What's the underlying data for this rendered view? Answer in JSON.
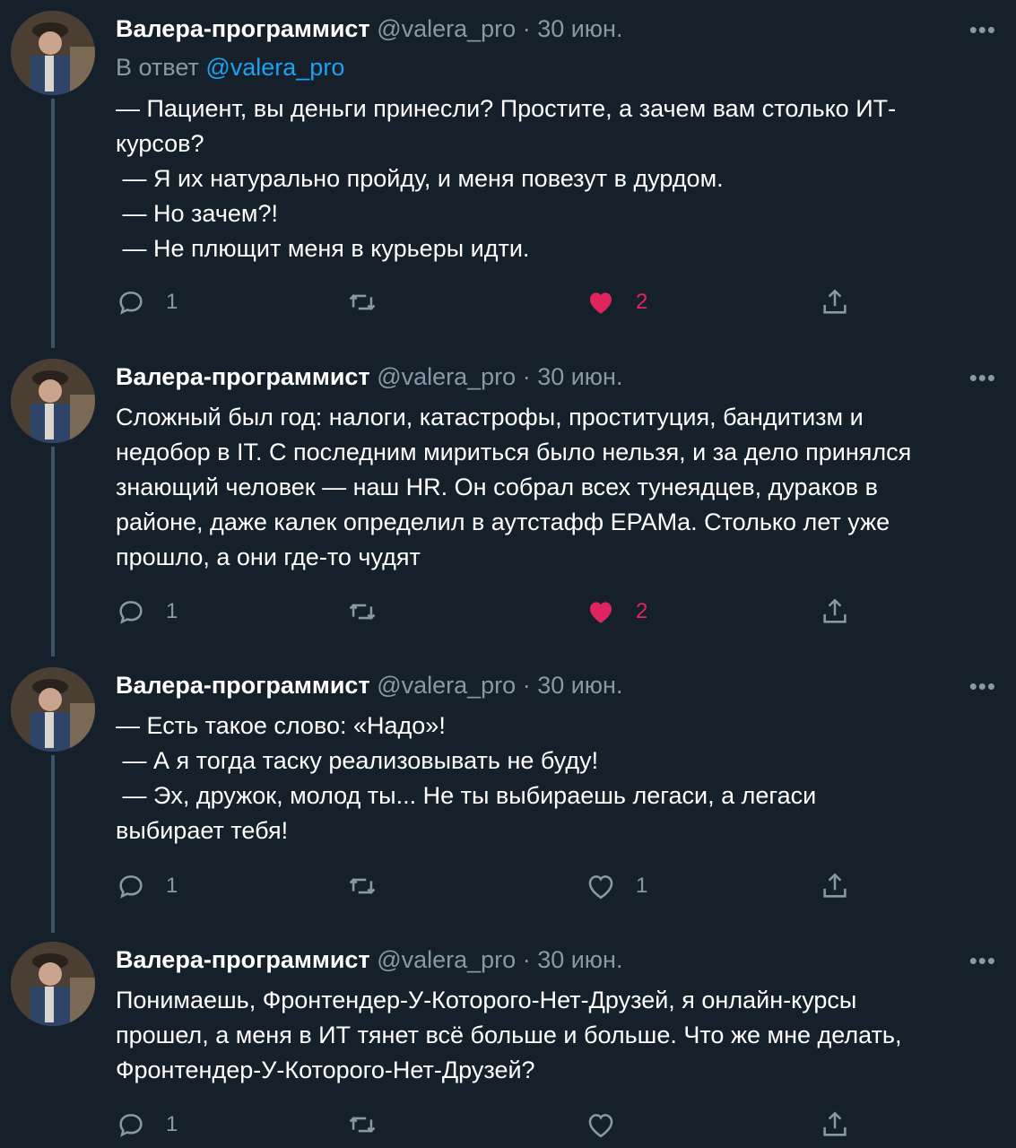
{
  "tweets": [
    {
      "name": "Валера-программист",
      "handle": "@valera_pro",
      "date": "· 30 июн.",
      "more": "•••",
      "reply_prefix": "В ответ",
      "reply_handle": "@valera_pro",
      "text": "— Пациент, вы деньги принесли? Простите, а зачем вам столько ИТ-\nкурсов?\n — Я их натурально пройду, и меня повезут в дурдом.\n — Но зачем?!\n — Не плющит меня в курьеры идти.",
      "reply_count": "1",
      "retweet_count": "",
      "like_count": "2",
      "liked": true
    },
    {
      "name": "Валера-программист",
      "handle": "@valera_pro",
      "date": "· 30 июн.",
      "more": "•••",
      "text": "Сложный был год: налоги, катастрофы, проституция, бандитизм и\nнедобор в IT. С последним мириться было нельзя, и за дело принялся\nзнающий человек — наш HR. Он собрал всех тунеядцев, дураков в\nрайоне, даже калек определил в аутстафф EPAMа. Столько лет уже\nпрошло, а они где-то чудят",
      "reply_count": "1",
      "retweet_count": "",
      "like_count": "2",
      "liked": true
    },
    {
      "name": "Валера-программист",
      "handle": "@valera_pro",
      "date": "· 30 июн.",
      "more": "•••",
      "text": "— Есть такое слово: «Надо»!\n — А я тогда таску реализовывать не буду!\n — Эх, дружок, молод ты... Не ты выбираешь легаси, а легаси\nвыбирает тебя!",
      "reply_count": "1",
      "retweet_count": "",
      "like_count": "1",
      "liked": false
    },
    {
      "name": "Валера-программист",
      "handle": "@valera_pro",
      "date": "· 30 июн.",
      "more": "•••",
      "text": "Понимаешь, Фронтендер-У-Которого-Нет-Друзей, я онлайн-курсы\nпрошел, а меня в ИТ тянет всё больше и больше. Что же мне делать,\nФронтендер-У-Которого-Нет-Друзей?",
      "reply_count": "1",
      "retweet_count": "",
      "like_count": "",
      "liked": false
    }
  ],
  "icons": {
    "reply": "reply-icon",
    "retweet": "retweet-icon",
    "like": "heart-icon",
    "share": "share-icon",
    "more": "more-icon"
  },
  "colors": {
    "background": "#15202b",
    "secondary_text": "#8899a6",
    "link": "#1da1f2",
    "like": "#e0245e",
    "thread_line": "#3d5466"
  }
}
